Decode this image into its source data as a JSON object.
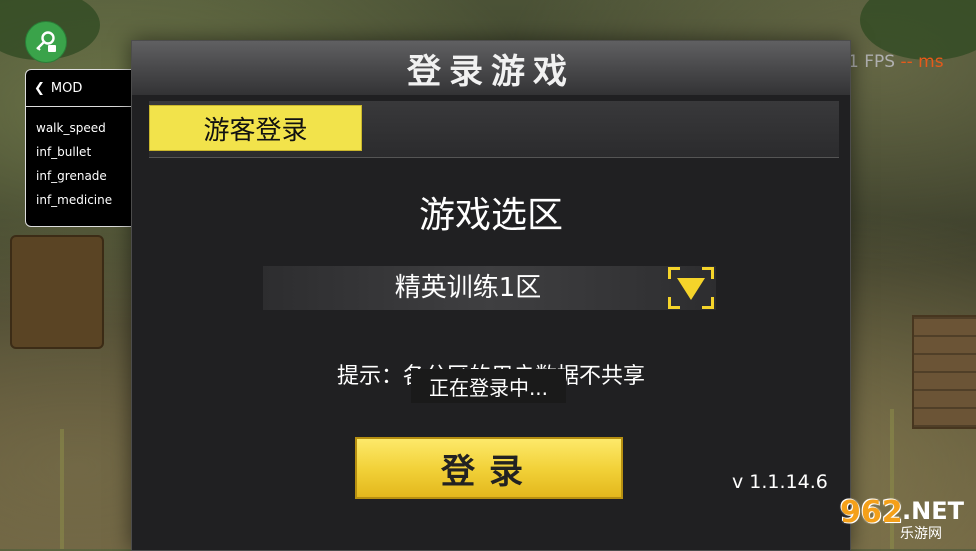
{
  "app": {
    "fps_value": "1 FPS",
    "fps_ms_placeholder": "--",
    "fps_ms_unit": "ms",
    "accent_color": "#f2e34b"
  },
  "mod_menu": {
    "fab_icon": "key-lock-icon",
    "header_label": "MOD",
    "back_icon": "chevron-left-icon",
    "items": [
      {
        "label": "walk_speed",
        "enabled": false
      },
      {
        "label": "inf_bullet",
        "enabled": false
      },
      {
        "label": "inf_grenade",
        "enabled": false
      },
      {
        "label": "inf_medicine",
        "enabled": false
      }
    ]
  },
  "login_dialog": {
    "title": "登录游戏",
    "tabs": [
      {
        "label": "游客登录",
        "active": true
      }
    ],
    "server_section_title": "游戏选区",
    "selected_server": "精英训练1区",
    "dropdown_icon": "triangle-down-icon",
    "hint": "提示：各分区的用户数据不共享",
    "loading_toast": "正在登录中...",
    "login_button_label": "登录",
    "version": "v 1.1.14.6"
  },
  "watermark": {
    "number": "962",
    "suffix": ".NET",
    "site_cn": "乐游网"
  }
}
